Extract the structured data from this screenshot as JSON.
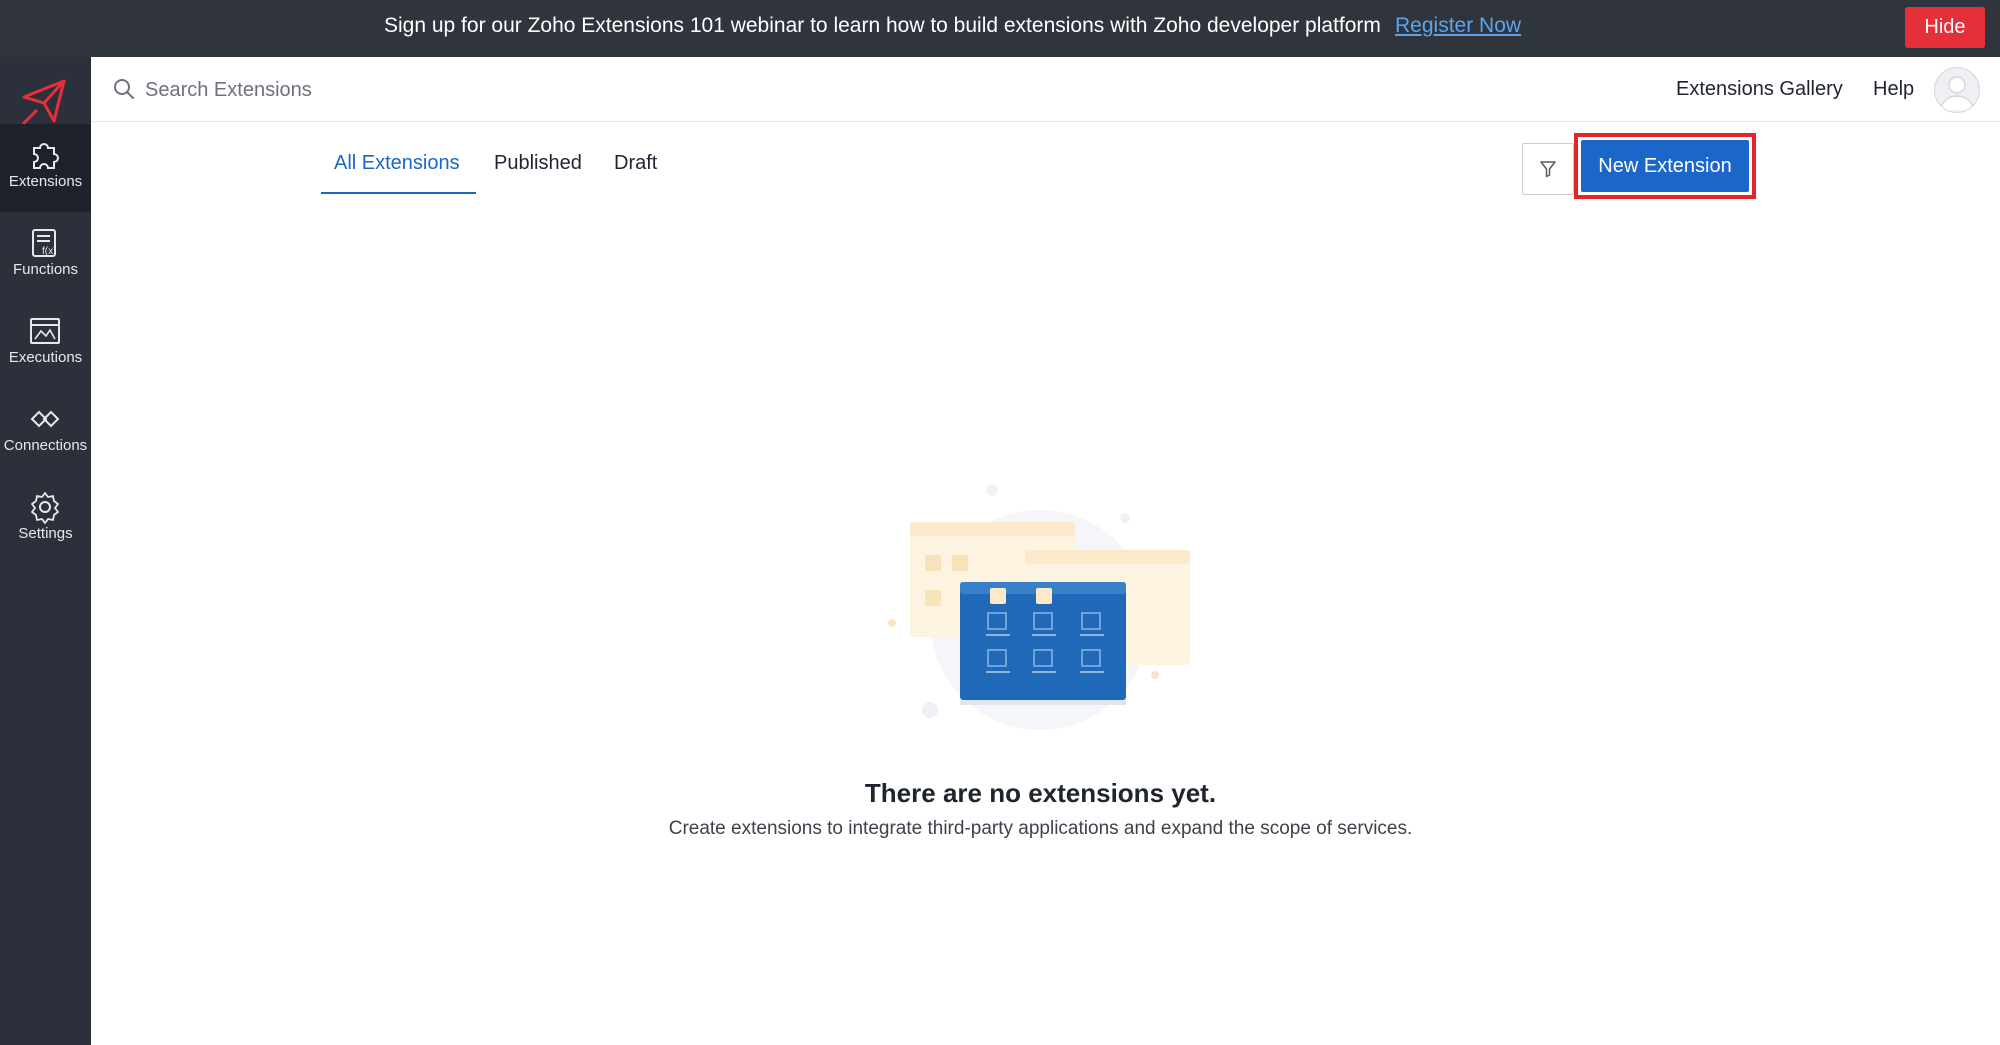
{
  "banner": {
    "text": "Sign up for our Zoho Extensions 101 webinar to learn how to build extensions with Zoho developer platform",
    "link_label": "Register Now",
    "hide_label": "Hide"
  },
  "sidebar": {
    "items": [
      {
        "label": "Extensions",
        "icon": "puzzle-icon",
        "active": true
      },
      {
        "label": "Functions",
        "icon": "function-icon",
        "active": false
      },
      {
        "label": "Executions",
        "icon": "executions-icon",
        "active": false
      },
      {
        "label": "Connections",
        "icon": "connections-icon",
        "active": false
      },
      {
        "label": "Settings",
        "icon": "gear-icon",
        "active": false
      }
    ]
  },
  "header": {
    "search_placeholder": "Search Extensions",
    "gallery_label": "Extensions Gallery",
    "help_label": "Help"
  },
  "tabs": [
    {
      "label": "All Extensions",
      "active": true
    },
    {
      "label": "Published",
      "active": false
    },
    {
      "label": "Draft",
      "active": false
    }
  ],
  "toolbar": {
    "filter_icon": "filter-icon",
    "new_extension_label": "New Extension"
  },
  "empty_state": {
    "title": "There are no extensions yet.",
    "subtitle": "Create extensions to integrate third-party applications and expand the scope of services."
  },
  "colors": {
    "banner_bg": "#30343d",
    "sidebar_bg": "#2c303a",
    "accent": "#1a66c9",
    "highlight": "#e3242b",
    "hide_button": "#e5303a"
  }
}
